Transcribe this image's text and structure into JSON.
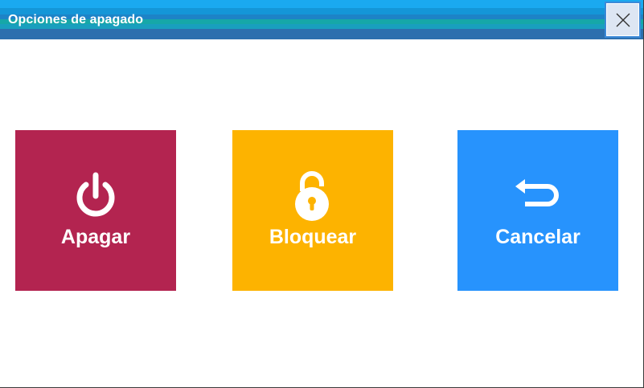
{
  "window": {
    "title": "Opciones de apagado",
    "close_icon": "close-icon"
  },
  "tiles": [
    {
      "label": "Apagar",
      "icon": "power-icon",
      "color": "#b32450"
    },
    {
      "label": "Bloquear",
      "icon": "lock-icon",
      "color": "#fdb300"
    },
    {
      "label": "Cancelar",
      "icon": "return-arrow-icon",
      "color": "#2793fd"
    }
  ],
  "colors": {
    "titlebar": "#1aa9f0",
    "title_text": "#ffffff",
    "close_button_bg": "#dde6f3",
    "close_button_border": "#3c8ad8"
  }
}
